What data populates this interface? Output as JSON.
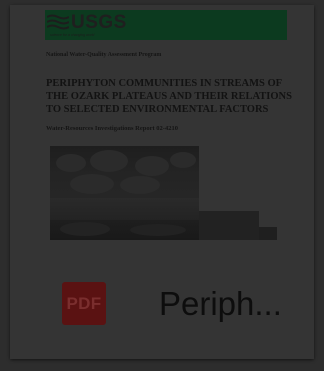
{
  "document": {
    "agency": "USGS",
    "agency_tagline": "science for a changing world",
    "program": "National Water-Quality Assessment Program",
    "title": "PERIPHYTON COMMUNITIES IN STREAMS OF THE OZARK PLATEAUS AND THEIR RELATIONS TO SELECTED ENVIRONMENTAL FACTORS",
    "report_number": "Water-Resources Investigations Report 02-4210"
  },
  "file": {
    "type_label": "PDF",
    "name": "Periph..."
  },
  "colors": {
    "usgs_green": "#0c3a1f",
    "pdf_red": "#5a1212"
  }
}
